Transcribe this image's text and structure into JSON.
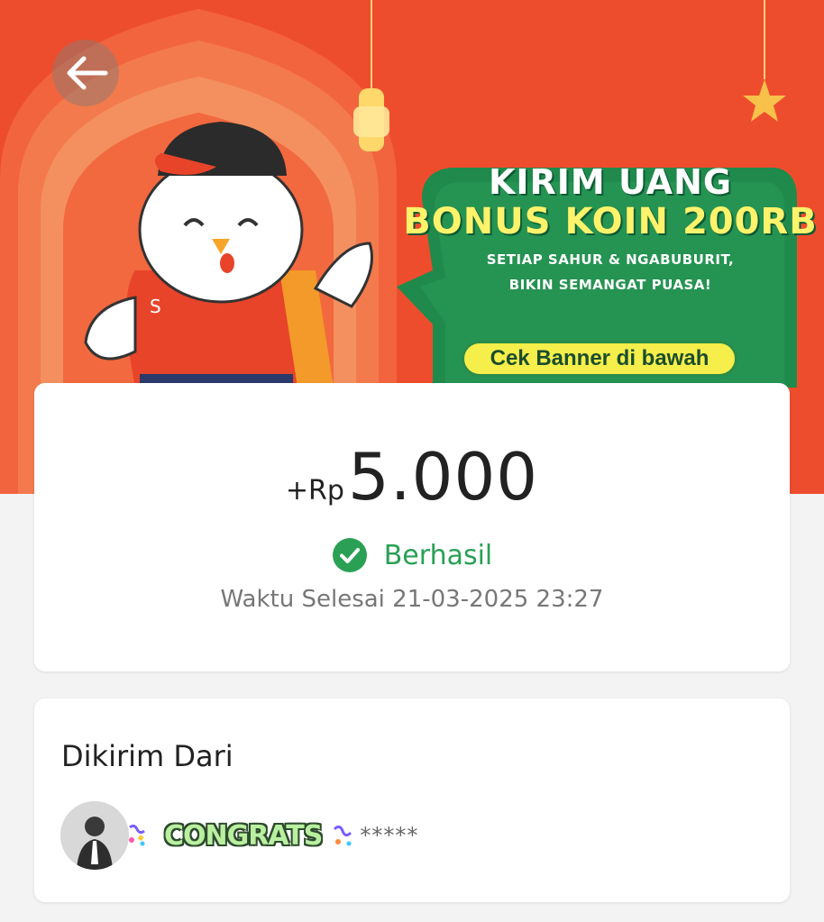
{
  "banner": {
    "promo_title_line1": "KIRIM UANG",
    "promo_title_line2": "BONUS KOIN 200RB",
    "promo_subtitle_line1": "SETIAP SAHUR & NGABUBURIT,",
    "promo_subtitle_line2": "BIKIN SEMANGAT PUASA!",
    "promo_cta": "Cek Banner di bawah",
    "mascot_badge": "S",
    "colors": {
      "background": "#ee4d2d",
      "bubble": "#1f8a4c",
      "cta": "#f6ee4a"
    }
  },
  "transaction": {
    "amount_prefix": "+Rp",
    "amount_value": "5.000",
    "status_label": "Berhasil",
    "completed_time": "Waktu Selesai 21-03-2025 23:27",
    "status_color": "#2aa055"
  },
  "sender": {
    "title": "Dikirim Dari",
    "sticker_text": "CONGRATS",
    "masked_name": "*****"
  },
  "icons": {
    "back": "arrow-left-icon",
    "status": "check-circle-icon",
    "confetti": "confetti-icon"
  }
}
